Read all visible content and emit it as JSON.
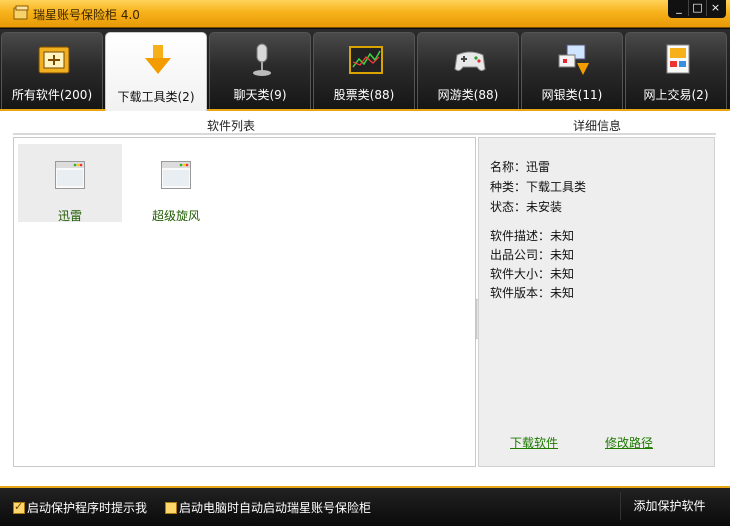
{
  "window": {
    "title": "瑞星账号保险柜 4.0",
    "controls": [
      "_",
      "□",
      "×"
    ]
  },
  "tabs": [
    {
      "label": "所有软件(200)",
      "icon": "software-box-icon",
      "active": false
    },
    {
      "label": "下载工具类(2)",
      "icon": "download-arrow-icon",
      "active": true
    },
    {
      "label": "聊天类(9)",
      "icon": "microphone-icon",
      "active": false
    },
    {
      "label": "股票类(88)",
      "icon": "stock-chart-icon",
      "active": false
    },
    {
      "label": "网游类(88)",
      "icon": "gamepad-icon",
      "active": false
    },
    {
      "label": "网银类(11)",
      "icon": "online-banking-icon",
      "active": false
    },
    {
      "label": "网上交易(2)",
      "icon": "online-trade-icon",
      "active": false
    }
  ],
  "software_list": {
    "header": "软件列表",
    "items": [
      {
        "name": "迅雷",
        "selected": true
      },
      {
        "name": "超级旋风",
        "selected": false
      }
    ]
  },
  "details": {
    "header": "详细信息",
    "name_row": "名称：迅雷",
    "category_row": "种类：下载工具类",
    "status_row": "状态：未安装",
    "description_row": "软件描述：未知",
    "company_row": "出品公司：未知",
    "size_row": "软件大小：未知",
    "version_row": "软件版本：未知",
    "download_link": "下载软件",
    "change_path_link": "修改路径"
  },
  "footer": {
    "prompt_on_start": {
      "label": "启动保护程序时提示我",
      "checked": true
    },
    "autostart": {
      "label": "启动电脑时自动启动瑞星账号保险柜",
      "checked": false
    },
    "add_button": "添加保护软件"
  },
  "colors": {
    "accent": "#e8a514",
    "link": "#1e7a00",
    "item_text": "#1e5a00"
  }
}
